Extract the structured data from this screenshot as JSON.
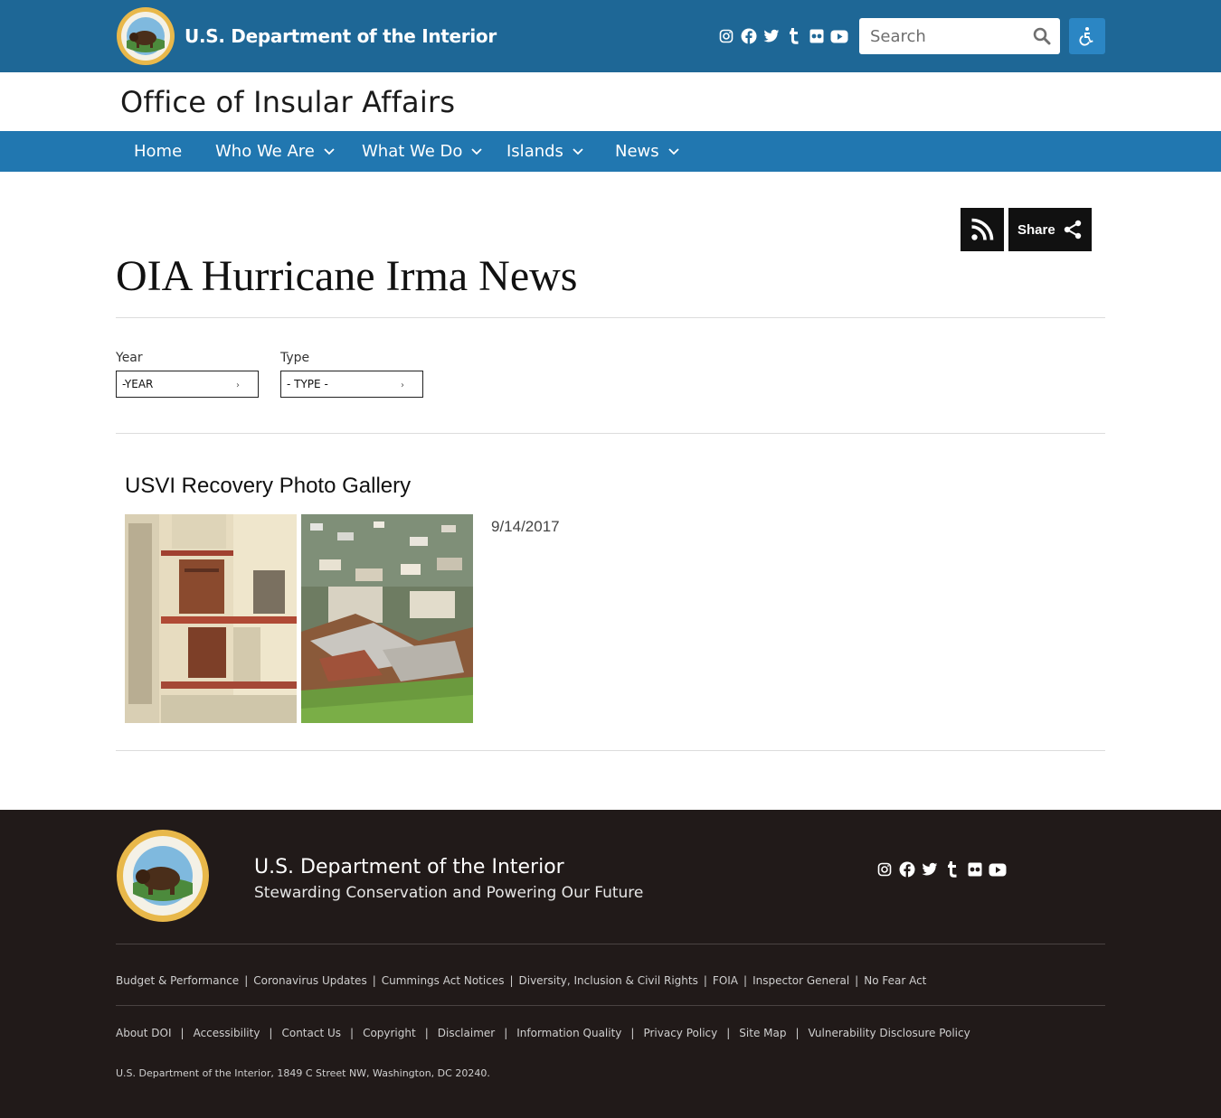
{
  "header": {
    "agency_name": "U.S. Department of the Interior",
    "search_placeholder": "Search",
    "social_icons": [
      "instagram-icon",
      "facebook-icon",
      "twitter-icon",
      "tumblr-icon",
      "flickr-icon",
      "youtube-icon"
    ]
  },
  "office": {
    "title": "Office of Insular Affairs"
  },
  "nav": {
    "items": [
      {
        "label": "Home",
        "has_menu": false
      },
      {
        "label": "Who We Are",
        "has_menu": true
      },
      {
        "label": "What We Do",
        "has_menu": true
      },
      {
        "label": "Islands",
        "has_menu": true
      },
      {
        "label": "News",
        "has_menu": true
      }
    ]
  },
  "actions": {
    "share_label": "Share"
  },
  "page": {
    "title": "OIA Hurricane Irma News"
  },
  "filters": {
    "year_label": "Year",
    "year_value": "-YEAR",
    "type_label": "Type",
    "type_value": "- TYPE -"
  },
  "news": [
    {
      "title": "USVI Recovery Photo Gallery",
      "date": "9/14/2017"
    }
  ],
  "footer": {
    "agency_name": "U.S. Department of the Interior",
    "tagline": "Stewarding Conservation and Powering Our Future",
    "links_row1": [
      "Budget & Performance",
      "Coronavirus Updates",
      "Cummings Act Notices",
      "Diversity, Inclusion & Civil Rights",
      "FOIA",
      "Inspector General",
      "No Fear Act"
    ],
    "links_row2": [
      "About DOI",
      "Accessibility",
      "Contact Us",
      "Copyright",
      "Disclaimer",
      "Information Quality",
      "Privacy Policy",
      "Site Map",
      "Vulnerability Disclosure Policy"
    ],
    "address": "U.S. Department of the Interior, 1849 C Street NW, Washington, DC 20240."
  },
  "colors": {
    "header_blue": "#1e6796",
    "nav_blue": "#2177b0",
    "footer_bg": "#211a19"
  }
}
